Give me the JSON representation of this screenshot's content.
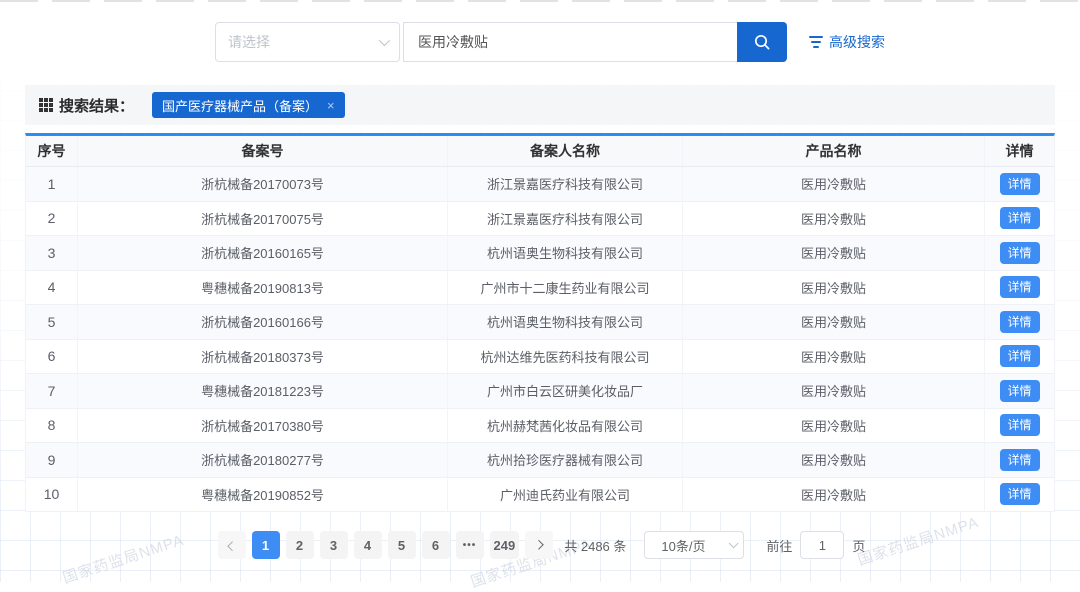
{
  "colors": {
    "primary_blue": "#1767d1",
    "button_blue": "#3d8df5",
    "table_top_border": "#2d8cf0"
  },
  "search": {
    "select_placeholder": "请选择",
    "query": "医用冷敷贴",
    "advanced_label": "高级搜索"
  },
  "results": {
    "label": "搜索结果：",
    "tag": "国产医疗器械产品（备案）",
    "tag_close": "×"
  },
  "table": {
    "columns": [
      "序号",
      "备案号",
      "备案人名称",
      "产品名称",
      "详情"
    ],
    "detail_label": "详情",
    "rows": [
      {
        "no": "1",
        "record_no": "浙杭械备20170073号",
        "registrant": "浙江景嘉医疗科技有限公司",
        "product": "医用冷敷贴"
      },
      {
        "no": "2",
        "record_no": "浙杭械备20170075号",
        "registrant": "浙江景嘉医疗科技有限公司",
        "product": "医用冷敷贴"
      },
      {
        "no": "3",
        "record_no": "浙杭械备20160165号",
        "registrant": "杭州语奥生物科技有限公司",
        "product": "医用冷敷贴"
      },
      {
        "no": "4",
        "record_no": "粤穗械备20190813号",
        "registrant": "广州市十二康生药业有限公司",
        "product": "医用冷敷贴"
      },
      {
        "no": "5",
        "record_no": "浙杭械备20160166号",
        "registrant": "杭州语奥生物科技有限公司",
        "product": "医用冷敷贴"
      },
      {
        "no": "6",
        "record_no": "浙杭械备20180373号",
        "registrant": "杭州达维先医药科技有限公司",
        "product": "医用冷敷贴"
      },
      {
        "no": "7",
        "record_no": "粤穗械备20181223号",
        "registrant": "广州市白云区研美化妆品厂",
        "product": "医用冷敷贴"
      },
      {
        "no": "8",
        "record_no": "浙杭械备20170380号",
        "registrant": "杭州赫梵茜化妆品有限公司",
        "product": "医用冷敷贴"
      },
      {
        "no": "9",
        "record_no": "浙杭械备20180277号",
        "registrant": "杭州拾珍医疗器械有限公司",
        "product": "医用冷敷贴"
      },
      {
        "no": "10",
        "record_no": "粤穗械备20190852号",
        "registrant": "广州迪氏药业有限公司",
        "product": "医用冷敷贴"
      }
    ]
  },
  "pagination": {
    "pages": [
      "1",
      "2",
      "3",
      "4",
      "5",
      "6",
      "•••",
      "249"
    ],
    "active_page": "1",
    "total_label": "共 2486 条",
    "page_size": "10条/页",
    "goto_label": "前往",
    "goto_value": "1",
    "page_unit": "页"
  },
  "watermark": "国家药监局NMPA"
}
